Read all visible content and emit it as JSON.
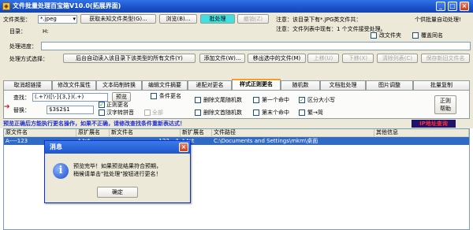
{
  "window": {
    "title": "文件批量处理百宝箱V10.0(拓展界面)",
    "min_label": "_",
    "max_label": "□",
    "close_label": "×"
  },
  "top": {
    "file_type_label": "文件类型：",
    "file_type_value": "*.jpeg",
    "get_unknown_button": "获取未知文件类型(G)...",
    "browse_button": "浏览(B)...",
    "batch_button": "批处理",
    "undo_button": "撤销(Z)",
    "note1": "注意：该目录下有*.JPG类文件共：",
    "note2": "个供批量自动处理!",
    "dir_label": "目录：",
    "dir_value": "H:",
    "note3": "注意：文件列表中现有：1 个文件接受处理。",
    "progress_label": "处理进度：",
    "subfolder_checkbox": "改文件夹",
    "overwrite_checkbox": "覆盖同名",
    "mode_label": "处理方式选择：",
    "auto_add_button": "后台自动读入该目录下该类型的所有文件(Y)",
    "add_file_button": "添加文件(W)...",
    "remove_button": "移出选中的文件(M)",
    "up_button": "上移(U)",
    "down_button": "下移(X)",
    "clear_list_button": "清除列表(C)",
    "save_name_button": "保存新旧文件名"
  },
  "tabs": [
    "取消超链接",
    "修改文件属性",
    "文本码制转换",
    "编辑文件摘要",
    "递配对更名",
    "样式正则更名",
    "随机数",
    "文档批处理",
    "图片调整",
    "批量复制"
  ],
  "regex_tab": {
    "find_label": "查找：",
    "find_value": "(.+?)([\\-]{3,})(.+)",
    "preview_button": "预览",
    "replace_label": "替换：",
    "replace_value": "$3$2$1",
    "regex_rename_checkbox": "正则更名",
    "chinese_pinyin_checkbox": "汉字转拼音",
    "condition_rename_checkbox": "条件更名",
    "all_checkbox": "全部",
    "delete_tail_random": "删除文尾随机数",
    "delete_head_random": "删除文首随机数",
    "first_hit": "第一个命中",
    "last_hit": "第末个命中",
    "case_sensitive": "区分大小写",
    "trad_to_simp": "繁→简",
    "help_button": "正则\n帮助"
  },
  "warning": {
    "text": "预览正确后方能执行更名操作，如果不正确，请修改查找条件重新表达式！",
    "ip_badge": "IP地址查询"
  },
  "table": {
    "columns": [
      "原文件名",
      "原扩展名",
      "新文件名",
      "新扩展名",
      "文件路径",
      "其他信息"
    ],
    "rows": [
      [
        "A----123",
        "*.txt",
        "123---A",
        "*.txt",
        "C:\\Documents and Settings\\mkm\\桌面",
        ""
      ]
    ]
  },
  "dialog": {
    "title": "消息",
    "line1": "预览完毕！如果预览结果符合预期，",
    "line2": "稍候请单击\"批处理\"按钮进行更名！",
    "ok_button": "确定",
    "close_label": "×"
  },
  "colors": {
    "titlebar": "#1a52c9",
    "tab_accent": "#ff9c1c",
    "warning_text": "#1f2fd0",
    "ip_badge_bg": "#20136a",
    "ip_badge_text": "#ff3030",
    "selection": "#316ac5"
  }
}
